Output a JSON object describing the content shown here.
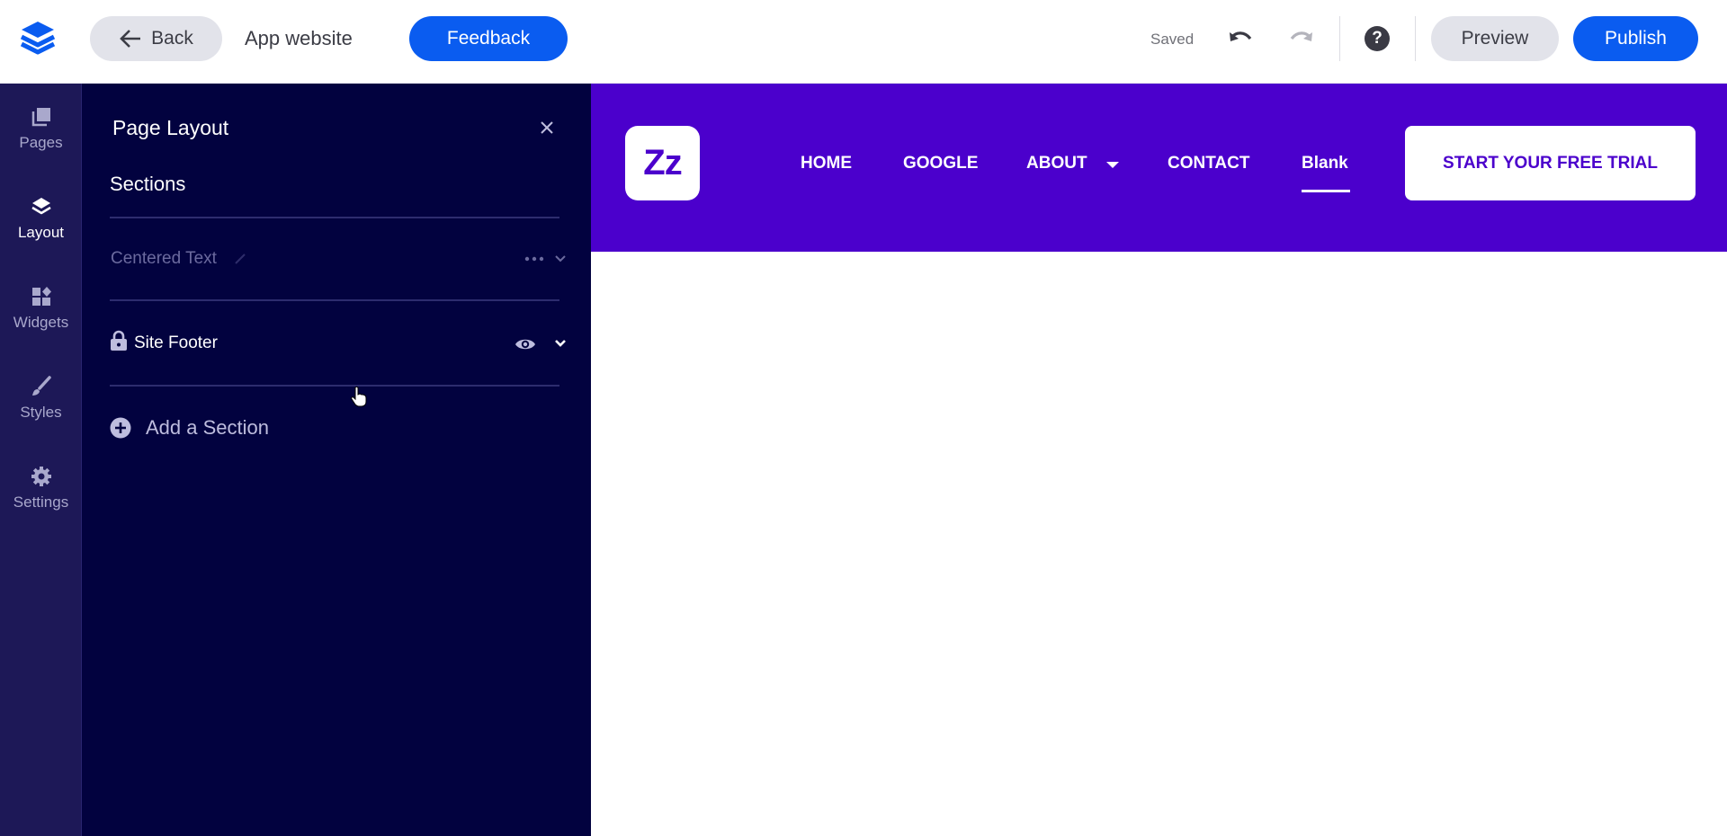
{
  "topbar": {
    "logo_icon": "stacked-layers-icon",
    "back_label": "Back",
    "site_name": "App website",
    "feedback_label": "Feedback",
    "save_status": "Saved",
    "undo_icon": "undo-icon",
    "redo_icon": "redo-icon",
    "help_icon": "help-icon",
    "help_glyph": "?",
    "preview_label": "Preview",
    "publish_label": "Publish"
  },
  "rail": {
    "items": [
      {
        "label": "Pages",
        "icon": "pages-icon",
        "active": false
      },
      {
        "label": "Layout",
        "icon": "layers-icon",
        "active": true
      },
      {
        "label": "Widgets",
        "icon": "widgets-icon",
        "active": false
      },
      {
        "label": "Styles",
        "icon": "brush-icon",
        "active": false
      },
      {
        "label": "Settings",
        "icon": "gear-icon",
        "active": false
      }
    ]
  },
  "panel": {
    "title": "Page Layout",
    "sections_heading": "Sections",
    "sections": [
      {
        "name": "Centered Text",
        "state": "dimmed",
        "icons": [
          "pencil-icon",
          "more-icon",
          "chevron-down-icon"
        ]
      },
      {
        "name": "Site Footer",
        "state": "locked",
        "icons": [
          "lock-icon",
          "eye-icon",
          "chevron-down-icon"
        ]
      }
    ],
    "add_section_label": "Add a Section"
  },
  "site": {
    "logo_text": "Zz",
    "nav": [
      "HOME",
      "GOOGLE",
      "ABOUT",
      "CONTACT",
      "Blank"
    ],
    "active_nav": "Blank",
    "cta_label": "START YOUR FREE TRIAL",
    "brand_color": "#4b00cc"
  },
  "colors": {
    "accent": "#0a5cf0",
    "rail_bg": "#1d1857",
    "panel_bg": "#02023f"
  }
}
